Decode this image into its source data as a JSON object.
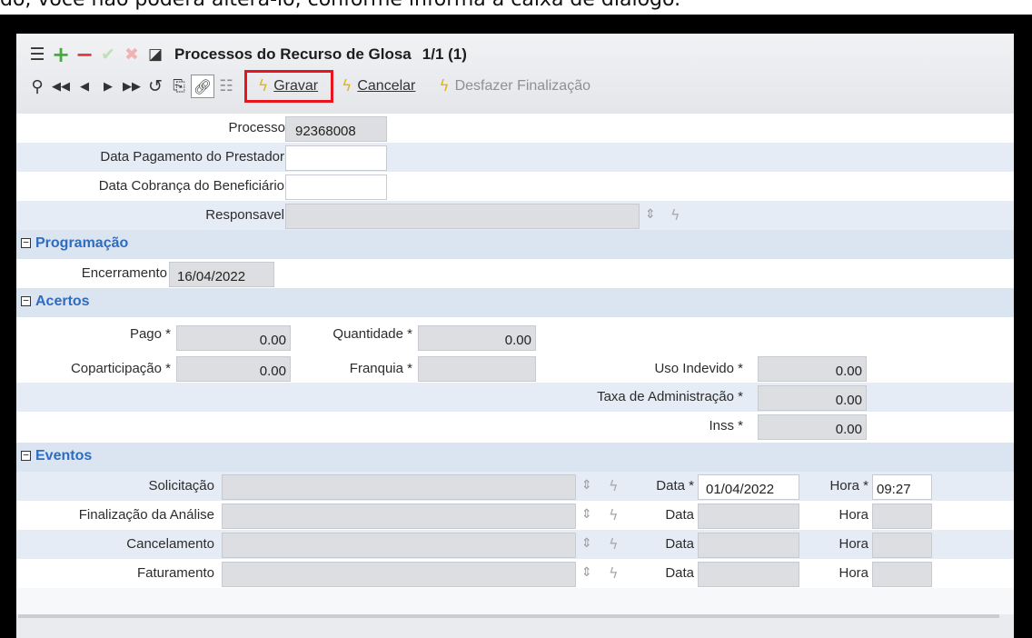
{
  "caption": "do, você não poderá alterá-lo, conforme informa a caixa de diálogo.",
  "window": {
    "title": "Processos do Recurso de Glosa",
    "record_counter": "1/1 (1)"
  },
  "toolbar": {
    "row1_icons": [
      "list-icon",
      "add-icon",
      "remove-icon",
      "confirm-icon",
      "cancel-icon",
      "save-icon"
    ],
    "row2_icons": [
      "search-icon",
      "first-icon",
      "prev-icon",
      "next-icon",
      "last-icon",
      "refresh-icon",
      "export-icon",
      "link-icon",
      "detail-icon"
    ],
    "gravar_label": "Gravar",
    "cancelar_label": "Cancelar",
    "desfazer_label": "Desfazer Finalização",
    "highlight_color": "#e8141e",
    "bolt_color": "#e8b400"
  },
  "form": {
    "processo_label": "Processo *",
    "processo_value": "92368008",
    "data_pagamento_label": "Data Pagamento do Prestador",
    "data_pagamento_value": "",
    "data_cobranca_label": "Data Cobrança do Beneficiário",
    "data_cobranca_value": "",
    "responsavel_label": "Responsavel",
    "responsavel_value": ""
  },
  "programacao": {
    "title": "Programação",
    "encerramento_label": "Encerramento",
    "encerramento_value": "16/04/2022"
  },
  "acertos": {
    "title": "Acertos",
    "pago_label": "Pago *",
    "pago_value": "0.00",
    "quantidade_label": "Quantidade *",
    "quantidade_value": "0.00",
    "coparticipacao_label": "Coparticipação *",
    "coparticipacao_value": "0.00",
    "franquia_label": "Franquia *",
    "franquia_value": "",
    "uso_indevido_label": "Uso Indevido *",
    "uso_indevido_value": "0.00",
    "taxa_label": "Taxa de Administração *",
    "taxa_value": "0.00",
    "inss_label": "Inss *",
    "inss_value": "0.00"
  },
  "eventos": {
    "title": "Eventos",
    "rows": [
      {
        "label": "Solicitação",
        "data_label": "Data *",
        "data_value": "01/04/2022",
        "hora_label": "Hora *",
        "hora_value": "09:27"
      },
      {
        "label": "Finalização da Análise",
        "data_label": "Data",
        "data_value": "",
        "hora_label": "Hora",
        "hora_value": ""
      },
      {
        "label": "Cancelamento",
        "data_label": "Data",
        "data_value": "",
        "hora_label": "Hora",
        "hora_value": ""
      },
      {
        "label": "Faturamento",
        "data_label": "Data",
        "data_value": "",
        "hora_label": "Hora",
        "hora_value": ""
      }
    ]
  }
}
